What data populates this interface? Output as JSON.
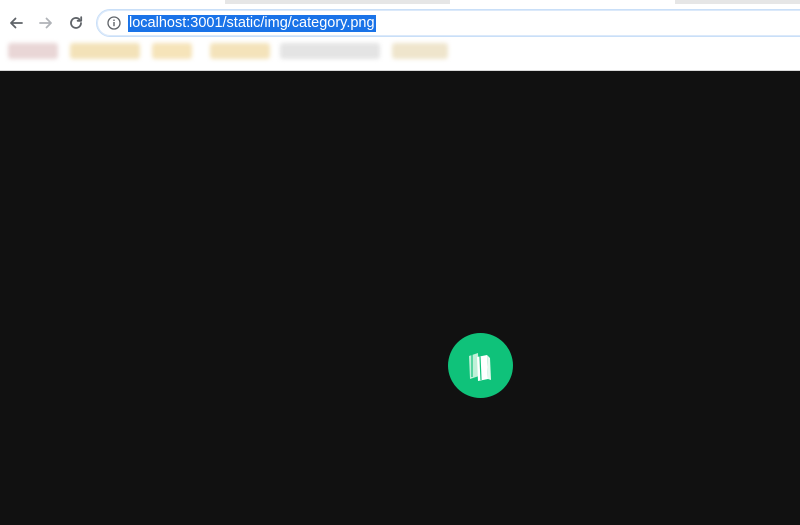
{
  "browser": {
    "address_bar": {
      "url": "localhost:3001/static/img/category.png",
      "selected": true,
      "icon": "info-icon"
    },
    "nav": {
      "back_icon": "arrow-left-icon",
      "forward_icon": "arrow-right-icon",
      "reload_icon": "reload-icon"
    },
    "colors": {
      "selection": "#1a73e8",
      "page_background": "#111111",
      "badge": "#0fc27a"
    }
  },
  "page": {
    "image_icon": "books-icon"
  }
}
